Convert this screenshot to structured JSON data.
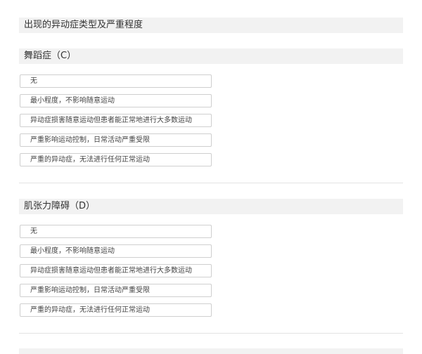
{
  "main_title": "出现的异动症类型及严重程度",
  "sections": [
    {
      "label": "舞蹈症（C）",
      "options": [
        "无",
        "最小程度，不影响随意运动",
        "异动症损害随意运动但患者能正常地进行大多数运动",
        "严重影响运动控制，日常活动严重受限",
        "严重的异动症，无法进行任何正常运动"
      ]
    },
    {
      "label": "肌张力障碍（D）",
      "options": [
        "无",
        "最小程度，不影响随意运动",
        "异动症损害随意运动但患者能正常地进行大多数运动",
        "严重影响运动控制，日常活动严重受限",
        "严重的异动症，无法进行任何正常运动"
      ]
    }
  ]
}
